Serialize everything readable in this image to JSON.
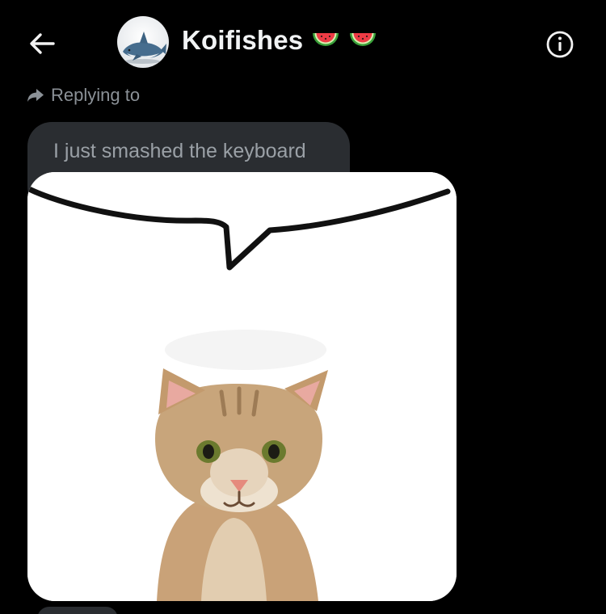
{
  "header": {
    "title": "Koifishes",
    "title_emoji": [
      "watermelon-icon",
      "watermelon-icon"
    ],
    "back_icon": "back-arrow-icon",
    "info_icon": "info-icon",
    "avatar_icon": "shark-plush-avatar"
  },
  "reply": {
    "label": "Replying to",
    "icon": "reply-arrow-icon"
  },
  "quoted_message": {
    "text": "I just smashed the keyboard"
  },
  "image_message": {
    "content": "cat-with-empty-speech-bubble-image"
  },
  "colors": {
    "background": "#000000",
    "bubble": "#2a2d31",
    "title_text": "#f1f3f4",
    "muted_text": "#8b9197",
    "quote_text": "#9aa0a6"
  }
}
